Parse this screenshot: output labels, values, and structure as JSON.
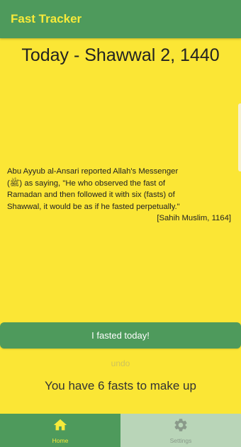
{
  "appbar": {
    "title": "Fast Tracker"
  },
  "today": {
    "title": "Today - Shawwal 2, 1440"
  },
  "hadith": {
    "lines": [
      " Abu Ayyub al-Ansari reported Allah's Messenger",
      "(ﷺ) as saying, \"He who observed the fast of",
      "Ramadan and then followed it with six (fasts) of",
      "Shawwal, it would be as if he fasted perpetually.\""
    ],
    "source": "[Sahih Muslim, 1164]"
  },
  "actions": {
    "fasted_label": "I fasted today!",
    "undo_label": "undo"
  },
  "status": {
    "makeup_text": "You have 6 fasts to make up"
  },
  "nav": {
    "items": [
      {
        "label": "Home",
        "icon": "home-icon",
        "active": true
      },
      {
        "label": "Settings",
        "icon": "gear-icon",
        "active": false
      }
    ]
  },
  "colors": {
    "background": "#fbe635",
    "primary_green": "#4e9a5c",
    "accent_yellow": "#f7ea3a",
    "inactive_tab": "#b9d5b8"
  }
}
